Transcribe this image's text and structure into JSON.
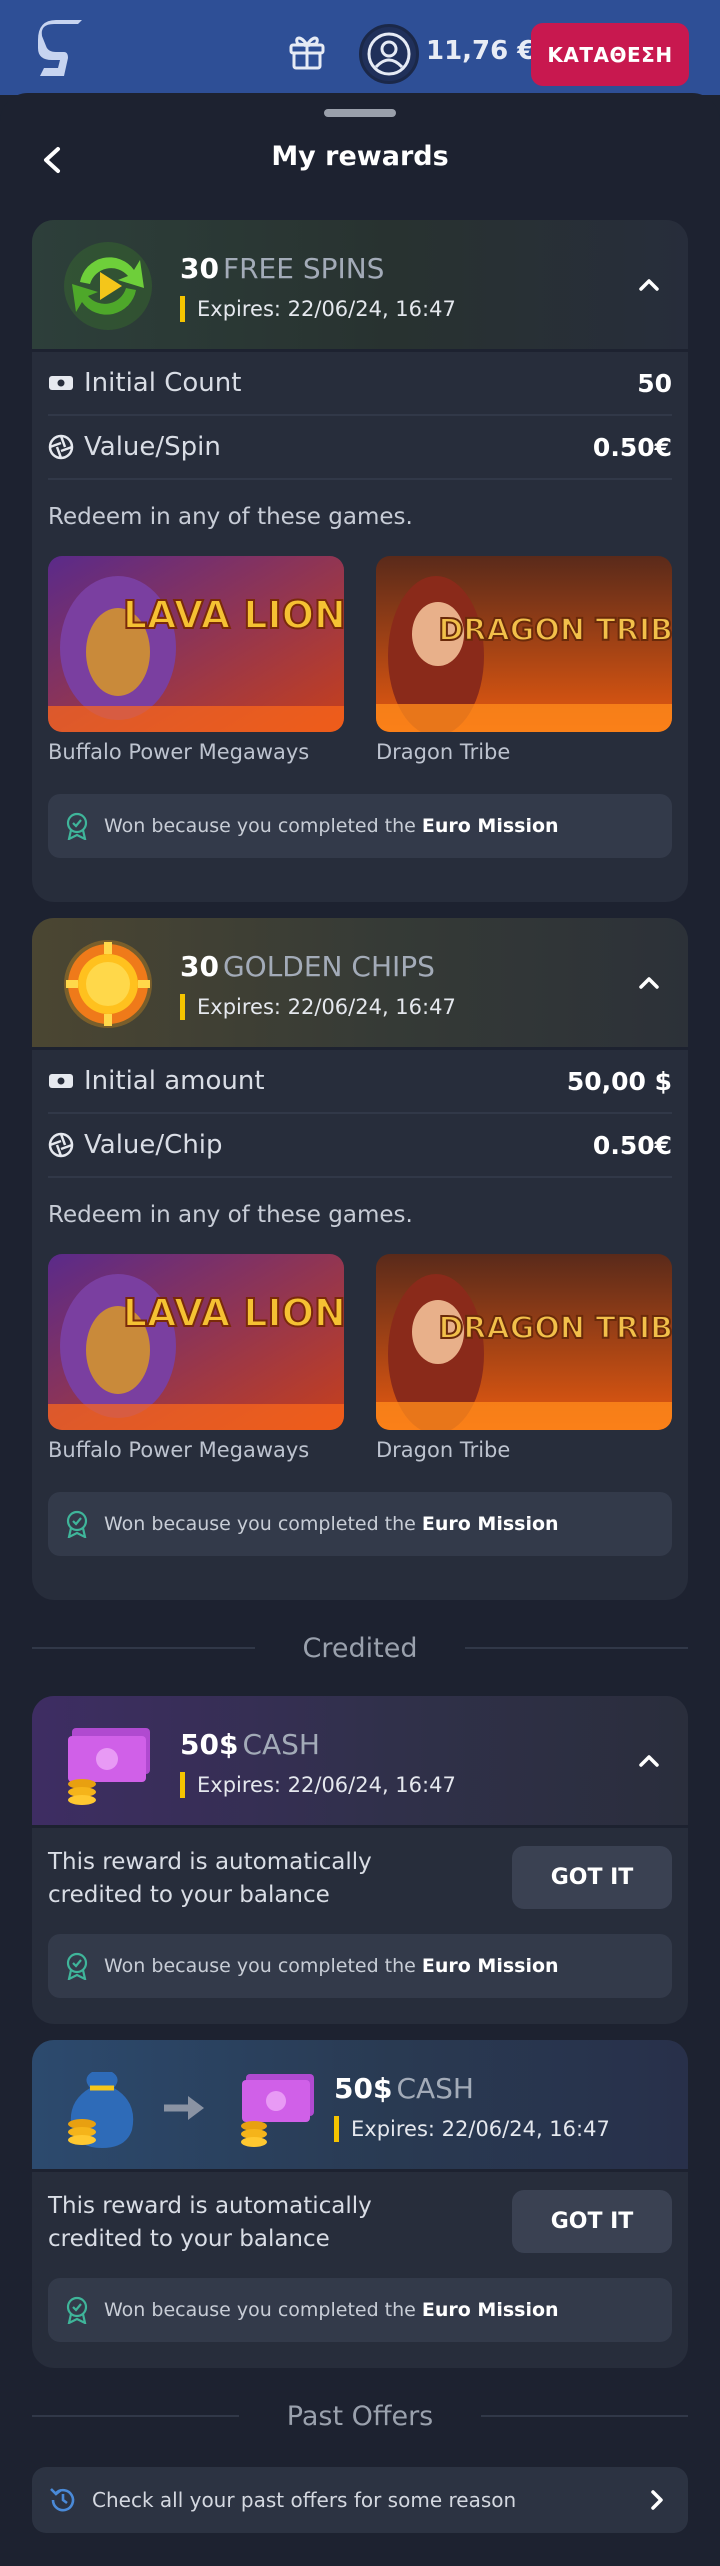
{
  "topbar": {
    "balance": "11,76 €",
    "deposit_label": "ΚΑΤΑΘΕΣΗ",
    "accent": "#c8184f",
    "bar_color": "#2e4f96"
  },
  "sheet": {
    "title": "My rewards"
  },
  "rewards": [
    {
      "qty": "30",
      "type": "FREE SPINS",
      "expires": "Expires:  22/06/24, 16:47",
      "icon": "free-spins-icon",
      "stats": [
        {
          "icon": "ticket-icon",
          "label": "Initial Count",
          "value": "50"
        },
        {
          "icon": "aperture-icon",
          "label": "Value/Spin",
          "value": "0.50€"
        }
      ],
      "redeem_text": "Redeem in any of these games.",
      "games": [
        {
          "name": "Buffalo Power Megaways",
          "art_text": "LAVA LIONS"
        },
        {
          "name": "Dragon Tribe",
          "art_text": "DRAGON TRIBE"
        }
      ],
      "won_prefix": "Won because you completed the",
      "won_mission": "Euro Mission"
    },
    {
      "qty": "30",
      "type": "GOLDEN CHIPS",
      "expires": "Expires:  22/06/24, 16:47",
      "icon": "golden-chip-icon",
      "stats": [
        {
          "icon": "ticket-icon",
          "label": "Initial amount",
          "value": "50,00 $"
        },
        {
          "icon": "aperture-icon",
          "label": "Value/Chip",
          "value": "0.50€"
        }
      ],
      "redeem_text": "Redeem in any of these games.",
      "games": [
        {
          "name": "Buffalo Power Megaways",
          "art_text": "LAVA LIONS"
        },
        {
          "name": "Dragon Tribe",
          "art_text": "DRAGON TRIBE"
        }
      ],
      "won_prefix": "Won because you completed the",
      "won_mission": "Euro Mission"
    }
  ],
  "credited_label": "Credited",
  "credited": [
    {
      "qty": "50$",
      "type": "CASH",
      "expires": "Expires:  22/06/24, 16:47",
      "icon": "cash-stack-icon",
      "auto_text": "This reward is automatically credited to your balance",
      "button": "GOT IT",
      "won_prefix": "Won because you completed the",
      "won_mission": "Euro Mission"
    },
    {
      "qty": "50$",
      "type": "CASH",
      "expires": "Expires:  22/06/24, 16:47",
      "icon": "money-bag-to-cash-icon",
      "auto_text": "This reward is automatically credited to your balance",
      "button": "GOT IT",
      "won_prefix": "Won because you completed the",
      "won_mission": "Euro Mission"
    }
  ],
  "past_label": "Past Offers",
  "past_offers_link": "Check all your past offers for some reason"
}
